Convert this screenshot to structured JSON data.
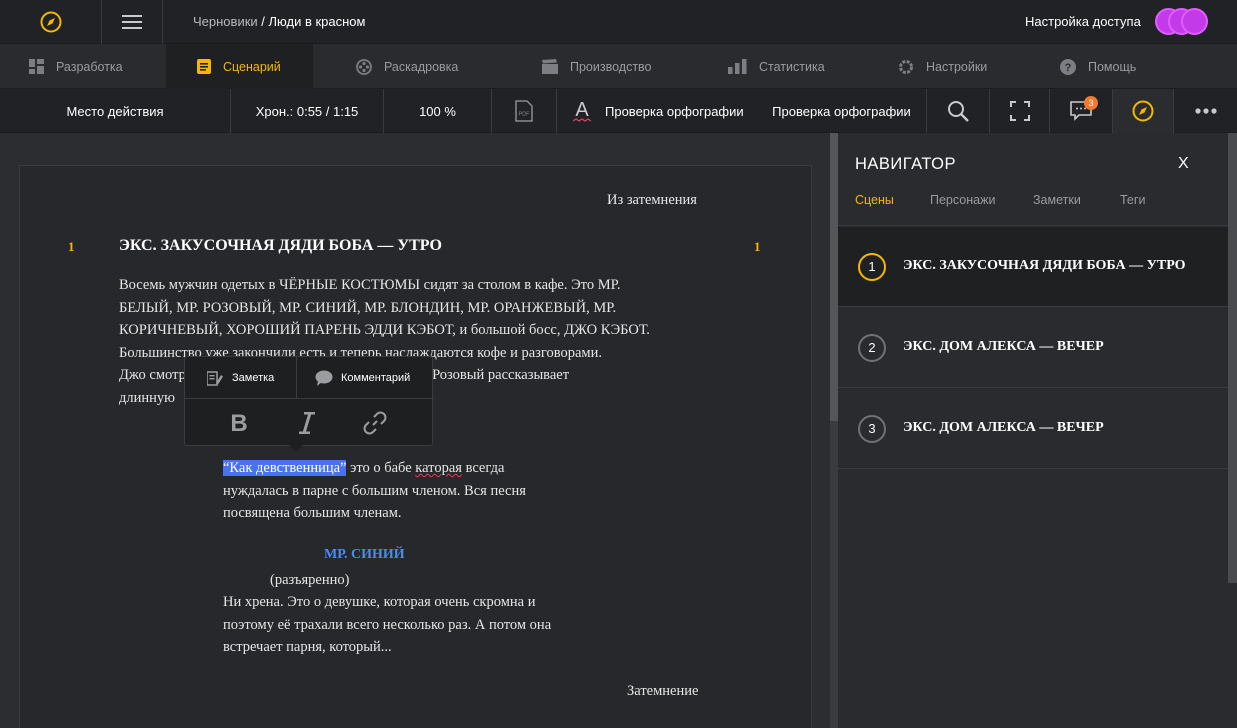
{
  "topbar": {
    "breadcrumb_root": "Черновики",
    "breadcrumb_sep": " / ",
    "breadcrumb_current": "Люди в красном",
    "access_label": "Настройка доступа"
  },
  "tabs": [
    {
      "label": "Разработка",
      "icon": "grid-icon",
      "active": false
    },
    {
      "label": "Сценарий",
      "icon": "script-icon",
      "active": true
    },
    {
      "label": "Раскадровка",
      "icon": "film-reel-icon",
      "active": false
    },
    {
      "label": "Производство",
      "icon": "clapper-icon",
      "active": false
    },
    {
      "label": "Статистика",
      "icon": "bar-chart-icon",
      "active": false
    },
    {
      "label": "Настройки",
      "icon": "gear-icon",
      "active": false
    },
    {
      "label": "Помощь",
      "icon": "help-icon",
      "active": false
    }
  ],
  "toolbar": {
    "location": "Место действия",
    "timing": "Хрон.: 0:55 / 1:15",
    "zoom": "100 %",
    "spellcheck_1": "Проверка орфографии",
    "spellcheck_2": "Проверка орфографии",
    "comments_count": "3"
  },
  "script": {
    "transition_in": "Из затемнения",
    "scene_number_left": "1",
    "scene_number_right": "1",
    "scene_heading": "ЭКС. ЗАКУСОЧНАЯ ДЯДИ БОБА — УТРО",
    "action_lines": [
      "Восемь мужчин одетых в ЧЁРНЫЕ КОСТЮМЫ сидят за столом в кафе. Это МР.",
      "БЕЛЫЙ, МР. РОЗОВЫЙ, МР. СИНИЙ, МР. БЛОНДИН, МР. ОРАНЖЕВЫЙ, МР.",
      "КОРИЧНЕВЫЙ, ХОРОШИЙ ПАРЕНЬ ЭДДИ КЭБОТ, и большой босс, ДЖО КЭБОТ.",
      "Большинство уже закончили есть и теперь наслаждаются кофе и разговорами.",
      "Джо смотрит в маленькую адресную книжки. Мр. Розовый рассказывает",
      "длинную"
    ],
    "dialogue1_highlight": "“Как девственница”",
    "dialogue1_rest_a": " это о бабе ",
    "dialogue1_misspelled": "каторая",
    "dialogue1_rest_b": " всегда",
    "dialogue1_line2": "нуждалась в парне с большим членом. Вся песня",
    "dialogue1_line3": "посвящена большим членам.",
    "character2": "МР. СИНИЙ",
    "parenthetical": "(разъяренно)",
    "dialogue2_lines": [
      "Ни хрена. Это о девушке, которая очень скромна и",
      "поэтому её трахали всего несколько раз. А потом она",
      "встречает парня, который..."
    ],
    "transition_out": "Затемнение"
  },
  "popup": {
    "note_label": "Заметка",
    "comment_label": "Комментарий"
  },
  "navigator": {
    "title": "НАВИГАТОР",
    "close": "X",
    "tabs": [
      "Сцены",
      "Персонажи",
      "Заметки",
      "Теги"
    ],
    "scenes": [
      {
        "num": "1",
        "label": "ЭКС. ЗАКУСОЧНАЯ ДЯДИ БОБА — УТРО"
      },
      {
        "num": "2",
        "label": "ЭКС. ДОМ АЛЕКСА — ВЕЧЕР"
      },
      {
        "num": "3",
        "label": "ЭКС. ДОМ АЛЕКСА — ВЕЧЕР"
      }
    ]
  },
  "colors": {
    "accent": "#f5b800",
    "highlight": "#4a72f0",
    "character": "#4a8cf0",
    "avatar": "#c33be8",
    "badge": "#f07a2d"
  }
}
